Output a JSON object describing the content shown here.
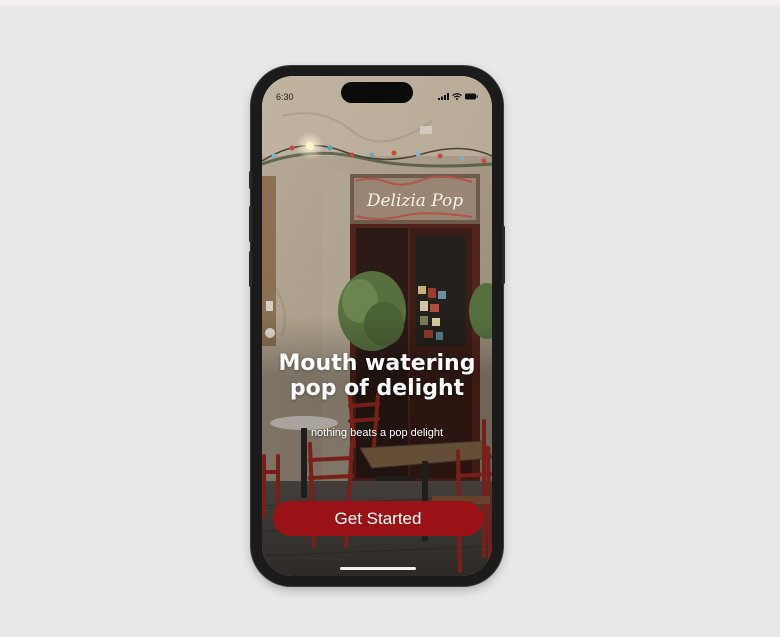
{
  "status_bar": {
    "time": "6:30",
    "icons": [
      "signal-icon",
      "wifi-icon",
      "battery-icon"
    ]
  },
  "storefront": {
    "sign_text": "Delizia Pop"
  },
  "hero": {
    "headline_line1": "Mouth watering",
    "headline_line2": "pop of delight",
    "subtitle": "nothing beats a pop delight"
  },
  "cta": {
    "label": "Get Started",
    "color": "#9b1216"
  },
  "colors": {
    "background": "#e8e8e8",
    "phone_frame": "#1b1b1c",
    "text": "#ffffff"
  }
}
